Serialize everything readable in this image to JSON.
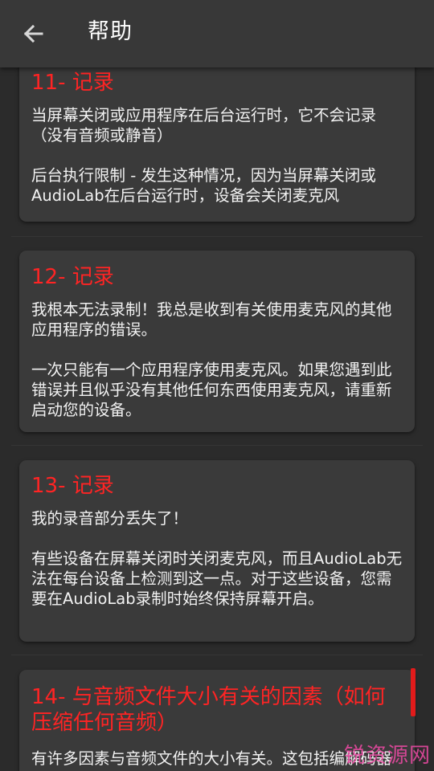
{
  "app_bar": {
    "title": "帮助",
    "back_icon": "arrow-left-icon"
  },
  "faq": [
    {
      "title": "11- 记录",
      "paragraphs": [
        "当屏幕关闭或应用程序在后台运行时，它不会记录（没有音频或静音）",
        "后台执行限制 - 发生这种情况，因为当屏幕关闭或AudioLab在后台运行时，设备会关闭麦克风"
      ]
    },
    {
      "title": "12- 记录",
      "paragraphs": [
        "我根本无法录制！我总是收到有关使用麦克风的其他应用程序的错误。",
        "一次只能有一个应用程序使用麦克风。如果您遇到此错误并且似乎没有其他任何东西使用麦克风，请重新启动您的设备。"
      ]
    },
    {
      "title": "13- 记录",
      "paragraphs": [
        "我的录音部分丢失了！",
        "有些设备在屏幕关闭时关闭麦克风，而且AudioLab无法在每台设备上检测到这一点。对于这些设备，您需要在AudioLab录制时始终保持屏幕开启。"
      ]
    },
    {
      "title": "14- 与音频文件大小有关的因素（如何压缩任何音频）",
      "paragraphs": [
        "有许多因素与音频文件的大小有关。这包括编解码器"
      ]
    }
  ],
  "watermark": "锐资源网",
  "colors": {
    "background": "#2b2b2b",
    "app_bar": "#383838",
    "card": "#3a3a3a",
    "accent_red": "#ff2424",
    "body_text": "#f2f2f2"
  }
}
